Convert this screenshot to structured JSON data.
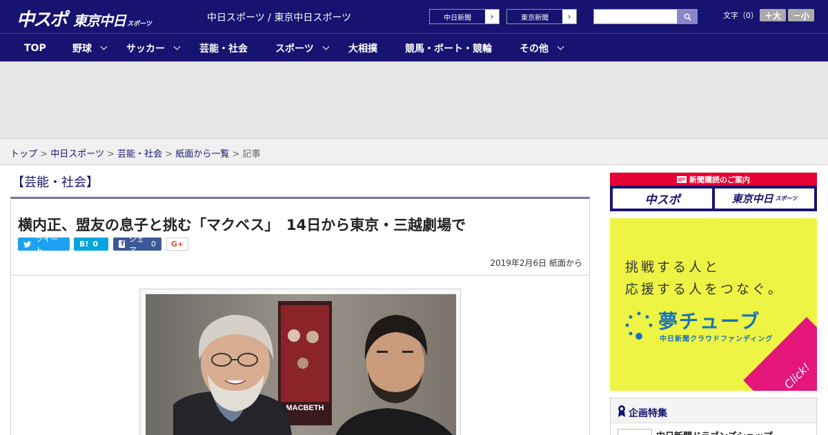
{
  "header": {
    "logo_main": "中スポ",
    "logo_sub": "東京中日",
    "logo_sub_small": "スポーツ",
    "site_title": "中日スポーツ / 東京中日スポーツ",
    "paper_links": [
      {
        "label": "中日新聞"
      },
      {
        "label": "東京新聞"
      }
    ],
    "search_placeholder": "",
    "font_size_label": "文字（0）",
    "font_larger": "＋大",
    "font_smaller": "－小"
  },
  "nav": {
    "items": [
      {
        "label": "TOP",
        "dropdown": false
      },
      {
        "label": "野球",
        "dropdown": true
      },
      {
        "label": "サッカー",
        "dropdown": true
      },
      {
        "label": "芸能・社会",
        "dropdown": false
      },
      {
        "label": "スポーツ",
        "dropdown": true
      },
      {
        "label": "大相撲",
        "dropdown": false
      },
      {
        "label": "競馬・ボート・競輪",
        "dropdown": false
      },
      {
        "label": "その他",
        "dropdown": true
      }
    ]
  },
  "breadcrumb": {
    "items": [
      "トップ",
      "中日スポーツ",
      "芸能・社会",
      "紙面から一覧"
    ],
    "current": "記事",
    "separator": ">"
  },
  "category": "【芸能・社会】",
  "article": {
    "headline": "横内正、盟友の息子と挑む「マクベス」　14日から東京・三越劇場で",
    "date": "2019年2月6日 紙面から",
    "share": {
      "tweet_label": "ツイート",
      "hatena_label": "B!",
      "hatena_count": "0",
      "fb_label": "シェア",
      "fb_count": "0",
      "gplus_label": "G+"
    },
    "photo_poster_text": "MACBETH"
  },
  "sidebar": {
    "subscribe_title": "新聞購読のご案内",
    "subscribe_buttons": [
      "中スポ",
      "東京中日"
    ],
    "subscribe_small": "スポーツ",
    "ad_line1": "挑戦する人と",
    "ad_line2": "応援する人をつなぐ。",
    "ad_brand": "夢チューブ",
    "ad_brand_sub": "中日新聞クラウドファンディング",
    "ad_click": "Click!",
    "feature_title": "企画特集",
    "feature_item": "中日新聞ドラゴンズショップ"
  },
  "colors": {
    "navy": "#171371",
    "red": "#e60033",
    "accent_purple": "#7d6fb0",
    "ad_yellow": "#eef443",
    "ad_pink": "#e4167b",
    "twitter": "#1da1f2",
    "hatena": "#00a4de",
    "facebook": "#3b5998"
  }
}
